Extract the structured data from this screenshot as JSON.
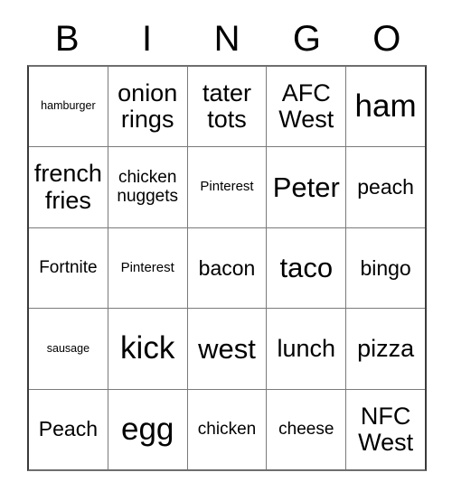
{
  "card": {
    "columns": [
      "B",
      "I",
      "N",
      "G",
      "O"
    ],
    "rows": [
      [
        {
          "text": "hamburger",
          "size": "fs-xs"
        },
        {
          "text": "onion\nrings",
          "size": "fs-xl"
        },
        {
          "text": "tater\ntots",
          "size": "fs-xl"
        },
        {
          "text": "AFC\nWest",
          "size": "fs-xl"
        },
        {
          "text": "ham",
          "size": "fs-hg"
        }
      ],
      [
        {
          "text": "french\nfries",
          "size": "fs-xl"
        },
        {
          "text": "chicken\nnuggets",
          "size": "fs-md"
        },
        {
          "text": "Pinterest",
          "size": "fs-sm"
        },
        {
          "text": "Peter",
          "size": "fs-xxl"
        },
        {
          "text": "peach",
          "size": "fs-lg"
        }
      ],
      [
        {
          "text": "Fortnite",
          "size": "fs-md"
        },
        {
          "text": "Pinterest",
          "size": "fs-sm"
        },
        {
          "text": "bacon",
          "size": "fs-lg"
        },
        {
          "text": "taco",
          "size": "fs-xxl"
        },
        {
          "text": "bingo",
          "size": "fs-lg"
        }
      ],
      [
        {
          "text": "sausage",
          "size": "fs-xs"
        },
        {
          "text": "kick",
          "size": "fs-hg"
        },
        {
          "text": "west",
          "size": "fs-xxl"
        },
        {
          "text": "lunch",
          "size": "fs-xl"
        },
        {
          "text": "pizza",
          "size": "fs-xl"
        }
      ],
      [
        {
          "text": "Peach",
          "size": "fs-lg"
        },
        {
          "text": "egg",
          "size": "fs-hg"
        },
        {
          "text": "chicken",
          "size": "fs-md"
        },
        {
          "text": "cheese",
          "size": "fs-md"
        },
        {
          "text": "NFC\nWest",
          "size": "fs-xl"
        }
      ]
    ]
  }
}
